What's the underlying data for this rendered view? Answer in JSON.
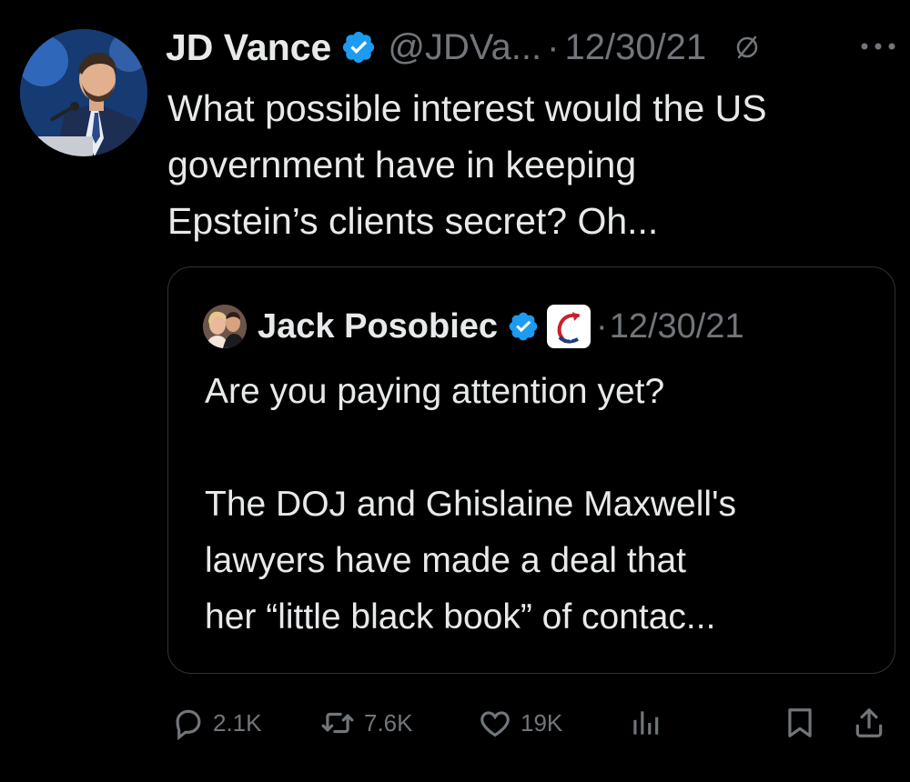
{
  "author": {
    "name": "JD Vance",
    "handle": "@JDVa...",
    "separator": "·",
    "date": "12/30/21",
    "verified_color": "#1d9bf0"
  },
  "tweet_text": "What possible interest would the US\ngovernment have in keeping\nEpstein’s clients secret? Oh...",
  "quoted": {
    "name": "Jack Posobiec",
    "separator": "·",
    "date": "12/30/21",
    "text": "Are you paying attention yet?\n\nThe DOJ and Ghislaine Maxwell's\nlawyers have made a deal that\nher “little black book” of contac..."
  },
  "actions": {
    "replies": "2.1K",
    "reposts": "7.6K",
    "likes": "19K"
  },
  "icons": {
    "verified": "verified-badge-icon",
    "muted": "muted-icon",
    "more": "more-icon",
    "reply": "reply-icon",
    "repost": "repost-icon",
    "like": "heart-icon",
    "views": "analytics-icon",
    "bookmark": "bookmark-icon",
    "share": "share-icon"
  },
  "colors": {
    "background": "#000000",
    "text": "#e7e9ea",
    "secondary": "#71767b",
    "border": "#2f3336",
    "accent": "#1d9bf0"
  }
}
